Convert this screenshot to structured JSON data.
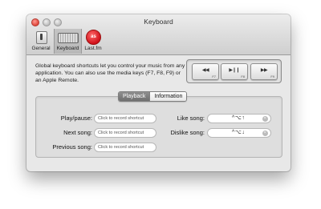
{
  "window": {
    "title": "Keyboard"
  },
  "toolbar": {
    "items": [
      {
        "label": "General"
      },
      {
        "label": "Keyboard"
      },
      {
        "label": "Last.fm"
      }
    ]
  },
  "description": "Global keyboard shortcuts let you control your music from any application. You can also use the media keys (F7, F8, F9) or an Apple Remote.",
  "media_keys": [
    {
      "symbol": "◀◀",
      "fn": "F7"
    },
    {
      "symbol": "▶❙❙",
      "fn": "F8"
    },
    {
      "symbol": "▶▶",
      "fn": "F9"
    }
  ],
  "tabs": {
    "playback": "Playback",
    "information": "Information"
  },
  "shortcuts": {
    "play_pause": {
      "label": "Play/pause:",
      "placeholder": "Click to record shortcut"
    },
    "next_song": {
      "label": "Next song:",
      "placeholder": "Click to record shortcut"
    },
    "previous_song": {
      "label": "Previous song:",
      "placeholder": "Click to record shortcut"
    },
    "like_song": {
      "label": "Like song:",
      "value": "^⌥↑"
    },
    "dislike_song": {
      "label": "Dislike song:",
      "value": "^⌥↓"
    }
  },
  "icons": {
    "clear": "clear-icon"
  }
}
